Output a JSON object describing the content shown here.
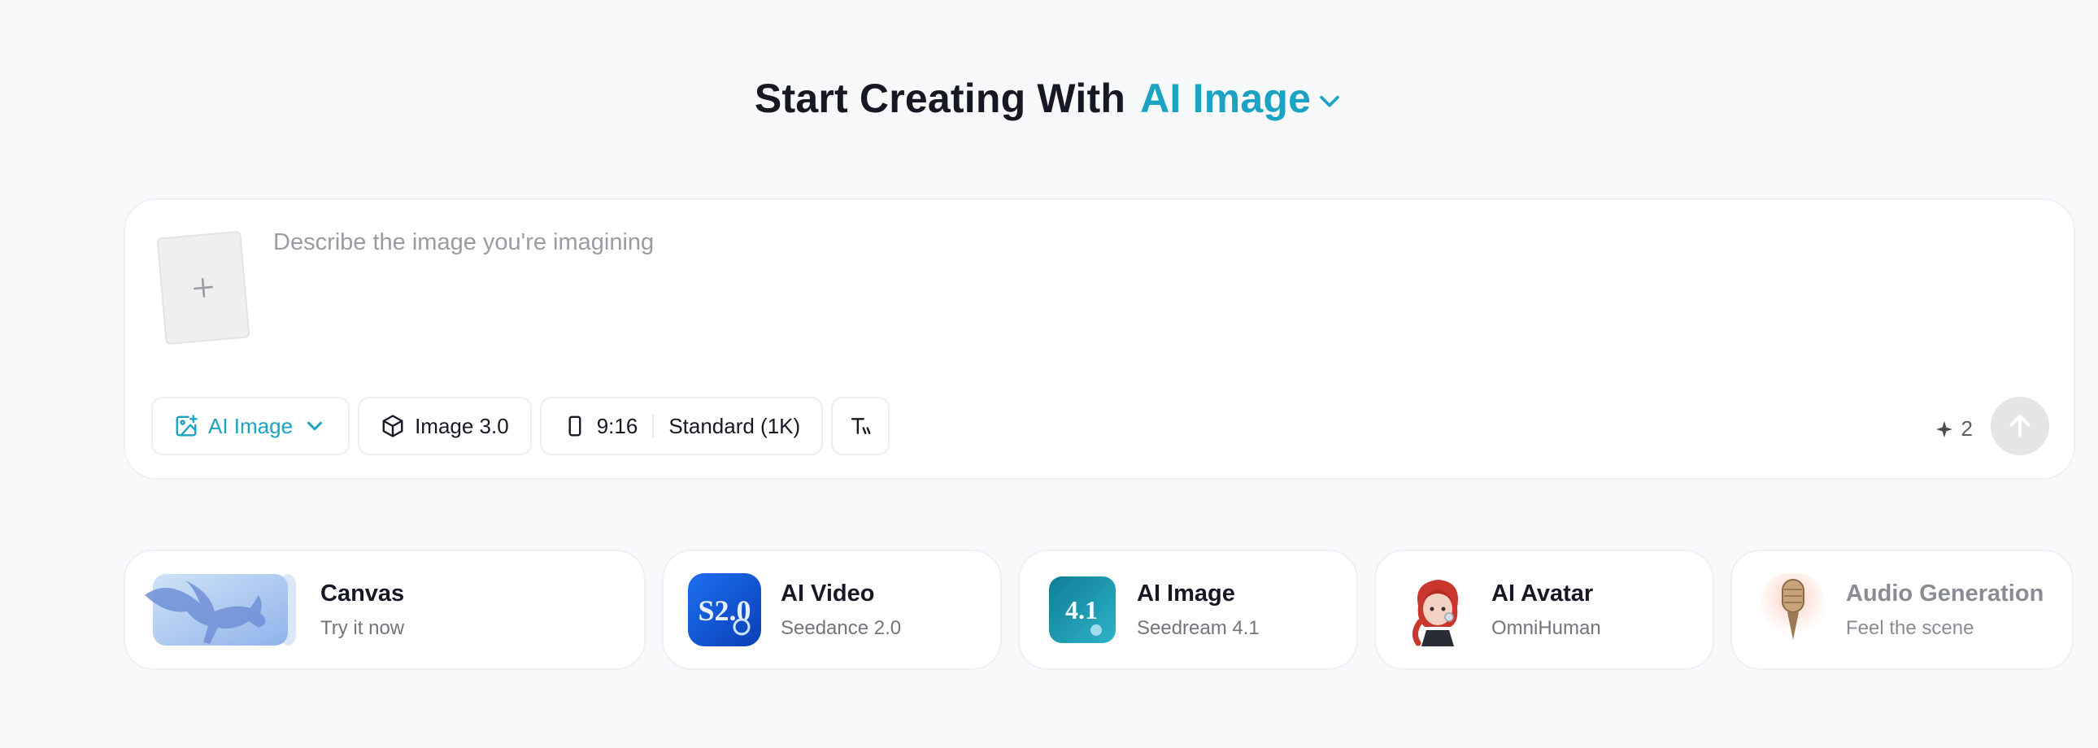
{
  "heading": {
    "prefix": "Start Creating With",
    "accent": "AI Image"
  },
  "prompt": {
    "placeholder": "Describe the image you're imagining",
    "value": ""
  },
  "toolbar": {
    "mode_label": "AI Image",
    "model_label": "Image 3.0",
    "ratio_label": "9:16",
    "resolution_label": "Standard (1K)"
  },
  "credits": {
    "count": "2"
  },
  "features": [
    {
      "title": "Canvas",
      "subtitle": "Try it now"
    },
    {
      "title": "AI Video",
      "subtitle": "Seedance 2.0",
      "badge": "S2.0"
    },
    {
      "title": "AI Image",
      "subtitle": "Seedream 4.1",
      "badge": "4.1"
    },
    {
      "title": "AI Avatar",
      "subtitle": "OmniHuman"
    },
    {
      "title": "Audio Generation",
      "subtitle": "Feel the scene"
    }
  ],
  "colors": {
    "accent": "#1aa3c2",
    "background": "#f8f9fb",
    "send_disabled": "#e4e5e7"
  },
  "icons": {
    "mode": "image-plus-icon",
    "model": "cube-icon",
    "ratio": "phone-portrait-icon",
    "text_style": "text-size-icon",
    "credits": "sparkle-icon",
    "send": "arrow-up-icon",
    "upload": "plus-icon"
  }
}
